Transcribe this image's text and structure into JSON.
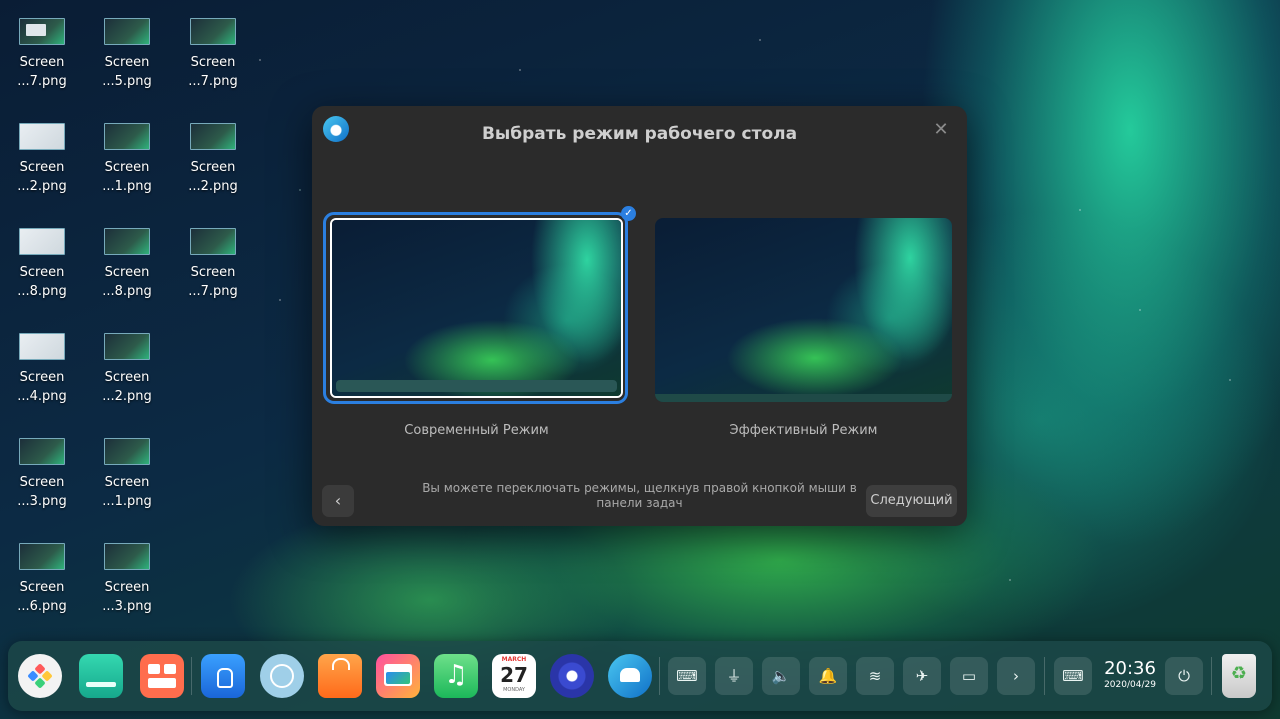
{
  "desktop": {
    "icons": [
      {
        "line1": "Screen",
        "line2": "...7.png"
      },
      {
        "line1": "Screen",
        "line2": "...5.png"
      },
      {
        "line1": "Screen",
        "line2": "...7.png"
      },
      {
        "line1": "Screen",
        "line2": "...2.png"
      },
      {
        "line1": "Screen",
        "line2": "...1.png"
      },
      {
        "line1": "Screen",
        "line2": "...2.png"
      },
      {
        "line1": "Screen",
        "line2": "...8.png"
      },
      {
        "line1": "Screen",
        "line2": "...8.png"
      },
      {
        "line1": "Screen",
        "line2": "...7.png"
      },
      {
        "line1": "Screen",
        "line2": "...4.png"
      },
      {
        "line1": "Screen",
        "line2": "...2.png"
      },
      {
        "line1": "Screen",
        "line2": "...3.png"
      },
      {
        "line1": "Screen",
        "line2": "...1.png"
      },
      {
        "line1": "Screen",
        "line2": "...6.png"
      },
      {
        "line1": "Screen",
        "line2": "...3.png"
      }
    ]
  },
  "dialog": {
    "title": "Выбрать режим рабочего стола",
    "close_glyph": "✕",
    "modes": [
      {
        "label": "Современный Режим",
        "selected": true
      },
      {
        "label": "Эффективный Режим",
        "selected": false
      }
    ],
    "check_glyph": "✓",
    "back_glyph": "‹",
    "hint": "Вы можете переключать режимы, щелкнув правой кнопкой мыши в панели задач",
    "next_label": "Следующий"
  },
  "taskbar": {
    "apps": [
      {
        "icon": "launcher-icon",
        "color": "#f4f4f4"
      },
      {
        "icon": "multitasking-icon",
        "color": "#2bc9a4"
      },
      {
        "icon": "file-manager-icon",
        "color": "#ff6d4d"
      },
      {
        "icon": "app-store-icon",
        "color": "#2a8cf0"
      },
      {
        "icon": "browser-icon",
        "color": "#8cc8e8"
      },
      {
        "icon": "store-bag-icon",
        "color": "#ff8a2a"
      },
      {
        "icon": "image-viewer-icon",
        "color": "#ff9a3a"
      },
      {
        "icon": "music-icon",
        "color": "#4fd47a"
      },
      {
        "icon": "calendar-icon",
        "color": "#ffffff"
      },
      {
        "icon": "settings-icon",
        "color": "#3a4ad0"
      },
      {
        "icon": "deepin-handshake-icon",
        "color": "#2e9ad8"
      }
    ],
    "calendar": {
      "month": "MARCH",
      "day": "27",
      "weekday": "MONDAY"
    },
    "tray": [
      {
        "icon": "keyboard-icon",
        "glyph": "⌨"
      },
      {
        "icon": "usb-icon",
        "glyph": "⏚"
      },
      {
        "icon": "volume-icon",
        "glyph": "🔈"
      },
      {
        "icon": "notification-bell-icon",
        "glyph": "🔔"
      },
      {
        "icon": "wifi-icon",
        "glyph": "≋"
      },
      {
        "icon": "airplane-mode-icon",
        "glyph": "✈"
      },
      {
        "icon": "battery-icon",
        "glyph": "▭"
      },
      {
        "icon": "expand-tray-icon",
        "glyph": "›"
      },
      {
        "icon": "onscreen-keyboard-icon",
        "glyph": "⌨"
      }
    ],
    "clock": {
      "time": "20:36",
      "date": "2020/04/29"
    },
    "power_glyph": "⏻",
    "trash_glyph": "♻"
  }
}
